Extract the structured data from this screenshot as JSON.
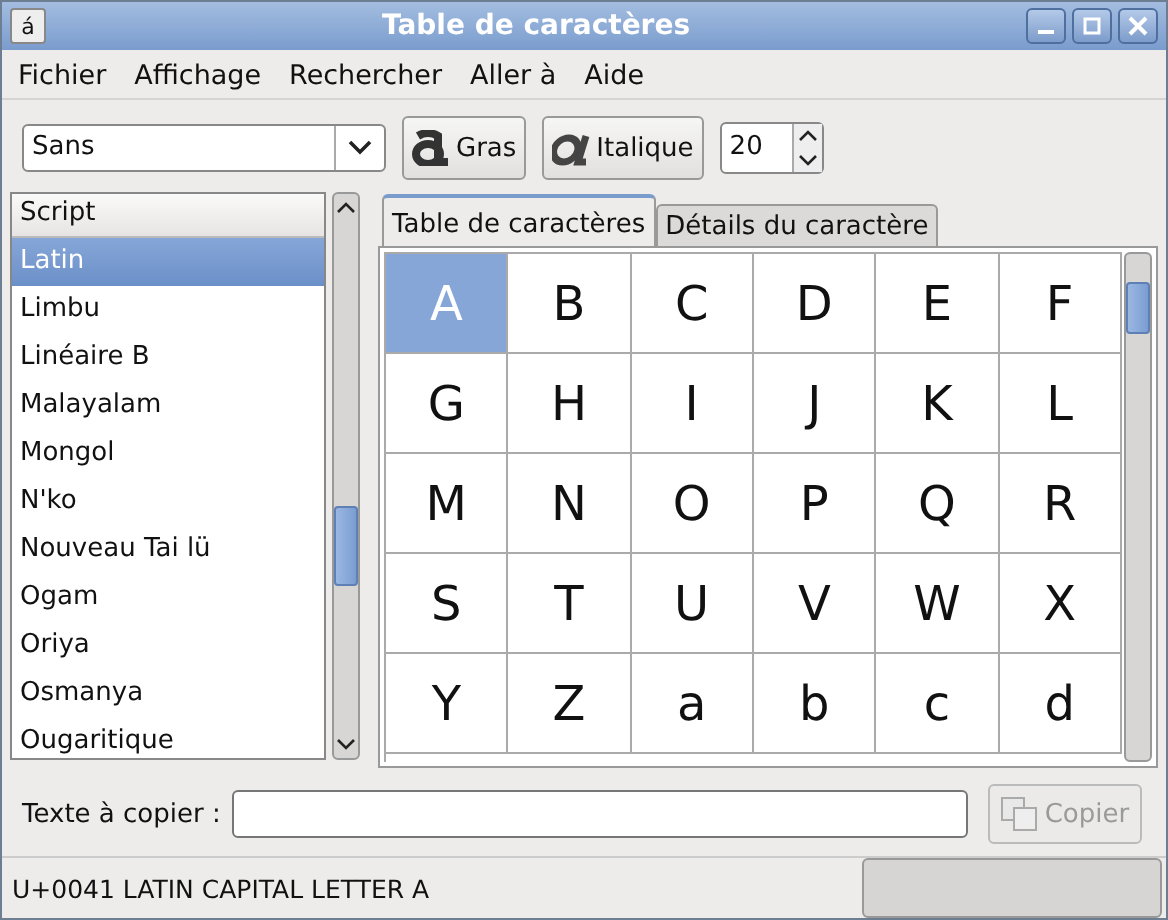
{
  "window": {
    "title": "Table de caractères",
    "icon": "á"
  },
  "menu": [
    {
      "label": "Fichier"
    },
    {
      "label": "Affichage"
    },
    {
      "label": "Rechercher"
    },
    {
      "label": "Aller à"
    },
    {
      "label": "Aide"
    }
  ],
  "toolbar": {
    "font": "Sans",
    "bold": {
      "label": "Gras"
    },
    "italic": {
      "label": "Italique"
    },
    "size": "20"
  },
  "script_list": {
    "header": "Script",
    "items": [
      {
        "label": "Latin",
        "selected": true
      },
      {
        "label": "Limbu",
        "selected": false
      },
      {
        "label": "Linéaire B",
        "selected": false
      },
      {
        "label": "Malayalam",
        "selected": false
      },
      {
        "label": "Mongol",
        "selected": false
      },
      {
        "label": "N'ko",
        "selected": false
      },
      {
        "label": "Nouveau Tai lü",
        "selected": false
      },
      {
        "label": "Ogam",
        "selected": false
      },
      {
        "label": "Oriya",
        "selected": false
      },
      {
        "label": "Osmanya",
        "selected": false
      },
      {
        "label": "Ougaritique",
        "selected": false
      }
    ]
  },
  "tabs": [
    {
      "label": "Table de caractères",
      "selected": true
    },
    {
      "label": "Détails du caractère",
      "selected": false
    }
  ],
  "grid": [
    {
      "char": "A",
      "selected": true
    },
    {
      "char": "B",
      "selected": false
    },
    {
      "char": "C",
      "selected": false
    },
    {
      "char": "D",
      "selected": false
    },
    {
      "char": "E",
      "selected": false
    },
    {
      "char": "F",
      "selected": false
    },
    {
      "char": "G",
      "selected": false
    },
    {
      "char": "H",
      "selected": false
    },
    {
      "char": "I",
      "selected": false
    },
    {
      "char": "J",
      "selected": false
    },
    {
      "char": "K",
      "selected": false
    },
    {
      "char": "L",
      "selected": false
    },
    {
      "char": "M",
      "selected": false
    },
    {
      "char": "N",
      "selected": false
    },
    {
      "char": "O",
      "selected": false
    },
    {
      "char": "P",
      "selected": false
    },
    {
      "char": "Q",
      "selected": false
    },
    {
      "char": "R",
      "selected": false
    },
    {
      "char": "S",
      "selected": false
    },
    {
      "char": "T",
      "selected": false
    },
    {
      "char": "U",
      "selected": false
    },
    {
      "char": "V",
      "selected": false
    },
    {
      "char": "W",
      "selected": false
    },
    {
      "char": "X",
      "selected": false
    },
    {
      "char": "Y",
      "selected": false
    },
    {
      "char": "Z",
      "selected": false
    },
    {
      "char": "a",
      "selected": false
    },
    {
      "char": "b",
      "selected": false
    },
    {
      "char": "c",
      "selected": false
    },
    {
      "char": "d",
      "selected": false
    }
  ],
  "copy_row": {
    "label": "Texte à copier :",
    "button": {
      "label": "Copier",
      "disabled": true
    }
  },
  "status_bar": "U+0041 LATIN CAPITAL LETTER A"
}
